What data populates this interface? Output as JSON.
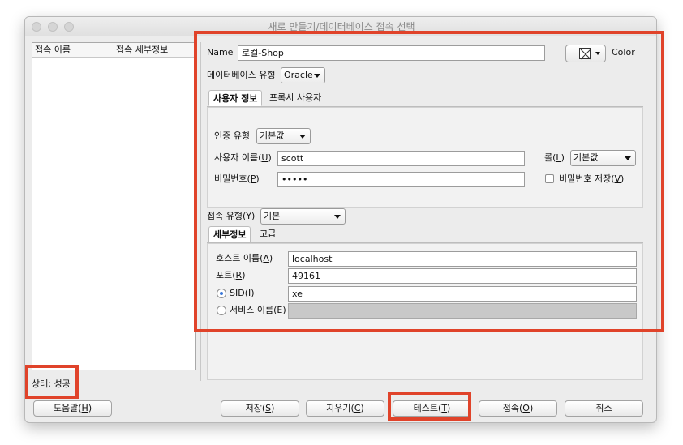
{
  "window": {
    "title": "새로 만들기/데이터베이스 접속 선택"
  },
  "connection_list": {
    "columns": [
      "접속 이름",
      "접속 세부정보"
    ]
  },
  "form": {
    "name_label": "Name",
    "name_value": "로컬-Shop",
    "color_label": "Color",
    "db_type_label": "데이터베이스 유형",
    "db_type_value": "Oracle"
  },
  "auth_tabs": [
    {
      "label": "사용자 정보",
      "active": true
    },
    {
      "label": "프록시 사용자",
      "active": false
    }
  ],
  "auth": {
    "auth_type_label": "인증 유형",
    "auth_type_value": "기본값",
    "username_label": "사용자 이름(",
    "username_mnemonic": "U",
    "username_value": "scott",
    "role_label": "롤(",
    "role_mnemonic": "L",
    "role_value": "기본값",
    "password_label": "비밀번호(",
    "password_mnemonic": "P",
    "password_value": "•••••",
    "save_password_label": "비밀번호 저장(",
    "save_password_mnemonic": "V",
    "save_password_checked": false
  },
  "connection": {
    "type_label": "접속 유형(",
    "type_mnemonic": "Y",
    "type_value": "기본"
  },
  "detail_tabs": [
    {
      "label": "세부정보",
      "active": true
    },
    {
      "label": "고급",
      "active": false
    }
  ],
  "details": {
    "host_label": "호스트 이름(",
    "host_mnemonic": "A",
    "host_value": "localhost",
    "port_label": "포트(",
    "port_mnemonic": "R",
    "port_value": "49161",
    "sid_label": "SID(",
    "sid_mnemonic": "I",
    "sid_value": "xe",
    "sid_selected": true,
    "service_label": "서비스 이름(",
    "service_mnemonic": "E",
    "service_value": ""
  },
  "status": {
    "text": "상태: 성공"
  },
  "buttons": {
    "help": {
      "label": "도움말(",
      "mnemonic": "H"
    },
    "save": {
      "label": "저장(",
      "mnemonic": "S"
    },
    "clear": {
      "label": "지우기(",
      "mnemonic": "C"
    },
    "test": {
      "label": "테스트(",
      "mnemonic": "T"
    },
    "connect": {
      "label": "접속(",
      "mnemonic": "O"
    },
    "cancel": {
      "label": "취소"
    }
  },
  "colors": {
    "highlight_annotation": "#e0432a",
    "radio_selected": "#3b78d8"
  }
}
